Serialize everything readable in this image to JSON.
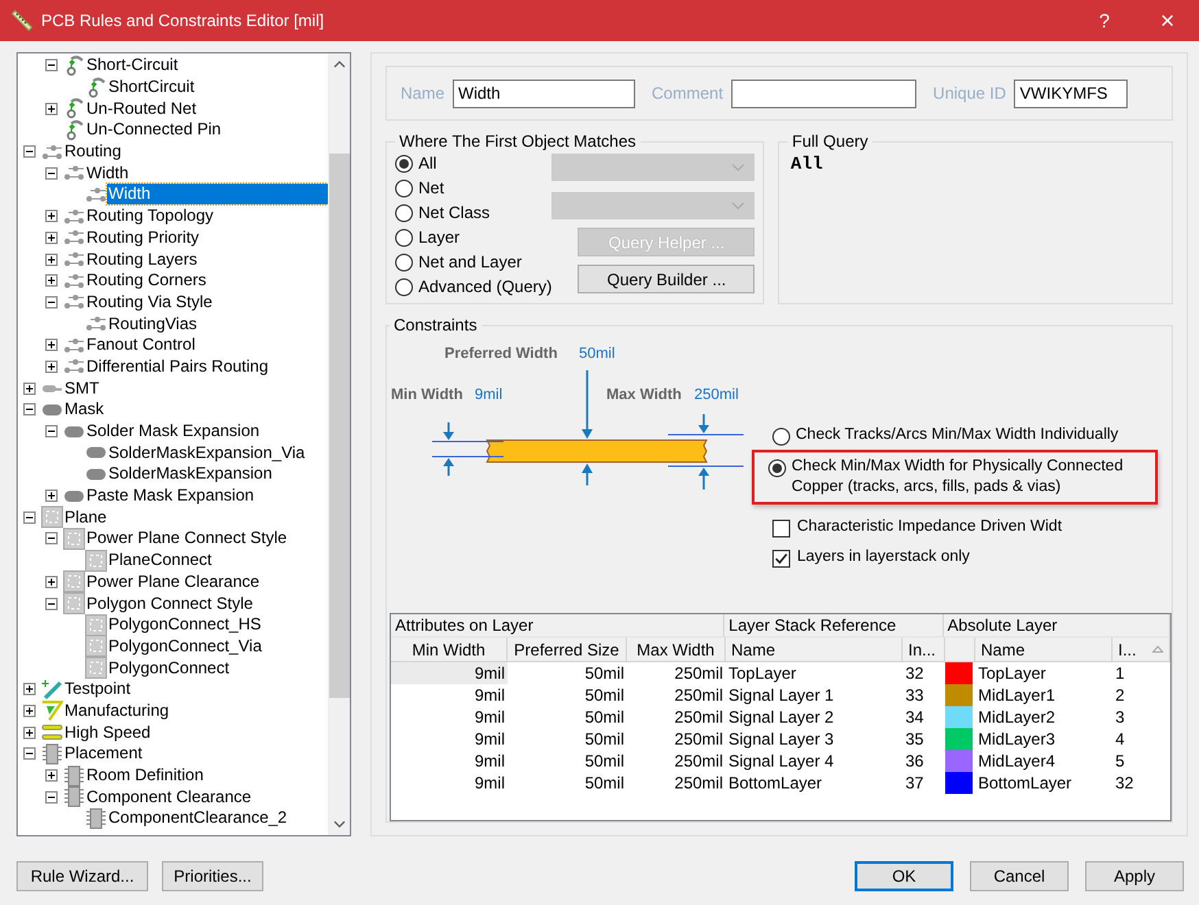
{
  "window": {
    "title": "PCB Rules and Constraints Editor [mil]",
    "help": "?",
    "close": "×"
  },
  "tree": [
    {
      "children": [
        {
          "label": "Short-Circuit",
          "kind": "electrical",
          "expanded": true,
          "selected": false,
          "children": [
            {
              "label": "ShortCircuit",
              "kind": "electrical",
              "selected": false
            }
          ]
        },
        {
          "label": "Un-Routed Net",
          "kind": "electrical",
          "expanded": false,
          "selected": false
        },
        {
          "label": "Un-Connected Pin",
          "kind": "electrical",
          "selected": false
        }
      ]
    },
    {
      "label": "Routing",
      "kind": "routing",
      "expanded": true,
      "selected": false,
      "children": [
        {
          "label": "Width",
          "kind": "routing",
          "expanded": true,
          "selected": false,
          "children": [
            {
              "label": "Width",
              "kind": "routing",
              "selected": true
            }
          ]
        },
        {
          "label": "Routing Topology",
          "kind": "routing",
          "expanded": false,
          "selected": false
        },
        {
          "label": "Routing Priority",
          "kind": "routing",
          "expanded": false,
          "selected": false
        },
        {
          "label": "Routing Layers",
          "kind": "routing",
          "expanded": false,
          "selected": false
        },
        {
          "label": "Routing Corners",
          "kind": "routing",
          "expanded": false,
          "selected": false
        },
        {
          "label": "Routing Via Style",
          "kind": "routing",
          "expanded": true,
          "selected": false,
          "children": [
            {
              "label": "RoutingVias",
              "kind": "routing",
              "selected": false
            }
          ]
        },
        {
          "label": "Fanout Control",
          "kind": "routing",
          "expanded": false,
          "selected": false
        },
        {
          "label": "Differential Pairs Routing",
          "kind": "routing",
          "expanded": false,
          "selected": false
        }
      ]
    },
    {
      "label": "SMT",
      "kind": "smt",
      "expanded": false,
      "selected": false
    },
    {
      "label": "Mask",
      "kind": "mask",
      "expanded": true,
      "selected": false,
      "children": [
        {
          "label": "Solder Mask Expansion",
          "kind": "mask",
          "expanded": true,
          "selected": false,
          "children": [
            {
              "label": "SolderMaskExpansion_Via",
              "kind": "mask",
              "selected": false
            },
            {
              "label": "SolderMaskExpansion",
              "kind": "mask",
              "selected": false
            }
          ]
        },
        {
          "label": "Paste Mask Expansion",
          "kind": "mask",
          "expanded": false,
          "selected": false
        }
      ]
    },
    {
      "label": "Plane",
      "kind": "plane",
      "expanded": true,
      "selected": false,
      "children": [
        {
          "label": "Power Plane Connect Style",
          "kind": "plane",
          "expanded": true,
          "selected": false,
          "children": [
            {
              "label": "PlaneConnect",
              "kind": "plane",
              "selected": false
            }
          ]
        },
        {
          "label": "Power Plane Clearance",
          "kind": "plane",
          "expanded": false,
          "selected": false
        },
        {
          "label": "Polygon Connect Style",
          "kind": "plane",
          "expanded": true,
          "selected": false,
          "children": [
            {
              "label": "PolygonConnect_HS",
              "kind": "plane",
              "selected": false
            },
            {
              "label": "PolygonConnect_Via",
              "kind": "plane",
              "selected": false
            },
            {
              "label": "PolygonConnect",
              "kind": "plane",
              "selected": false
            }
          ]
        }
      ]
    },
    {
      "label": "Testpoint",
      "kind": "testpoint",
      "expanded": false,
      "selected": false
    },
    {
      "label": "Manufacturing",
      "kind": "manufacturing",
      "expanded": false,
      "selected": false
    },
    {
      "label": "High Speed",
      "kind": "highspeed",
      "expanded": false,
      "selected": false
    },
    {
      "label": "Placement",
      "kind": "placement",
      "expanded": true,
      "selected": false,
      "children": [
        {
          "label": "Room Definition",
          "kind": "placement",
          "expanded": false,
          "selected": false
        },
        {
          "label": "Component Clearance",
          "kind": "placement",
          "expanded": true,
          "selected": false,
          "children": [
            {
              "label": "ComponentClearance_2",
              "kind": "placement",
              "selected": false
            }
          ]
        }
      ]
    }
  ],
  "fields": [
    {
      "label": "Name",
      "value": "Width"
    },
    {
      "label": "Comment"
    },
    {
      "label": "Unique ID",
      "value": "VWIKYMFS"
    }
  ],
  "scope": {
    "title": "Where The First Object Matches",
    "options": [
      {
        "label": "All",
        "selected": true
      },
      {
        "label": "Net",
        "selected": false
      },
      {
        "label": "Net Class",
        "selected": false
      },
      {
        "label": "Layer",
        "selected": false
      },
      {
        "label": "Net and Layer",
        "selected": false
      },
      {
        "label": "Advanced (Query)",
        "selected": false
      }
    ],
    "dropdowns": [
      {
        "disabled": true
      },
      {
        "disabled": true
      }
    ],
    "buttons": [
      {
        "label": "Query Helper ...",
        "disabled": true
      },
      {
        "label": "Query Builder ...",
        "disabled": false
      }
    ]
  },
  "full_query": {
    "title": "Full Query",
    "text": "All"
  },
  "constraints": {
    "title": "Constraints",
    "diagram": {
      "preferred": {
        "label": "Preferred Width",
        "value": "50mil"
      },
      "min": {
        "label": "Min Width",
        "value": "9mil"
      },
      "max": {
        "label": "Max Width",
        "value": "250mil"
      }
    },
    "options": [
      {
        "kind": "radio",
        "label": "Check Tracks/Arcs Min/Max Width Individually",
        "selected": false,
        "highlighted": false
      },
      {
        "kind": "radio",
        "label": "Check Min/Max Width for Physically Connected Copper (tracks, arcs, fills, pads & vias)",
        "selected": true,
        "highlighted": true
      },
      {
        "kind": "checkbox",
        "label": "Characteristic Impedance Driven Widt",
        "checked": false
      },
      {
        "kind": "checkbox",
        "label": "Layers in layerstack only",
        "checked": true
      }
    ]
  },
  "table": {
    "groups": [
      {
        "label": "Attributes on Layer",
        "columns": [
          "Min Width",
          "Preferred Size",
          "Max Width"
        ]
      },
      {
        "label": "Layer Stack Reference",
        "columns": [
          "Name",
          "In..."
        ]
      },
      {
        "label": "Absolute Layer",
        "columns": [
          "Name",
          "I..."
        ]
      }
    ],
    "rows": [
      {
        "selected": true,
        "color": "#ff0000",
        "cells": [
          "9mil",
          "50mil",
          "250mil",
          "TopLayer",
          "32",
          "TopLayer",
          "1"
        ]
      },
      {
        "selected": false,
        "color": "#bf8c00",
        "cells": [
          "9mil",
          "50mil",
          "250mil",
          "Signal Layer 1",
          "33",
          "MidLayer1",
          "2"
        ]
      },
      {
        "selected": false,
        "color": "#70dbf8",
        "cells": [
          "9mil",
          "50mil",
          "250mil",
          "Signal Layer 2",
          "34",
          "MidLayer2",
          "3"
        ]
      },
      {
        "selected": false,
        "color": "#00c864",
        "cells": [
          "9mil",
          "50mil",
          "250mil",
          "Signal Layer 3",
          "35",
          "MidLayer3",
          "4"
        ]
      },
      {
        "selected": false,
        "color": "#9966ff",
        "cells": [
          "9mil",
          "50mil",
          "250mil",
          "Signal Layer 4",
          "36",
          "MidLayer4",
          "5"
        ]
      },
      {
        "selected": false,
        "color": "#0000ff",
        "cells": [
          "9mil",
          "50mil",
          "250mil",
          "BottomLayer",
          "37",
          "BottomLayer",
          "32"
        ]
      }
    ]
  },
  "footer": {
    "left": [
      "Rule Wizard...",
      "Priorities..."
    ],
    "right": [
      {
        "label": "OK",
        "default": true
      },
      {
        "label": "Cancel",
        "default": false
      },
      {
        "label": "Apply",
        "default": false
      }
    ]
  }
}
